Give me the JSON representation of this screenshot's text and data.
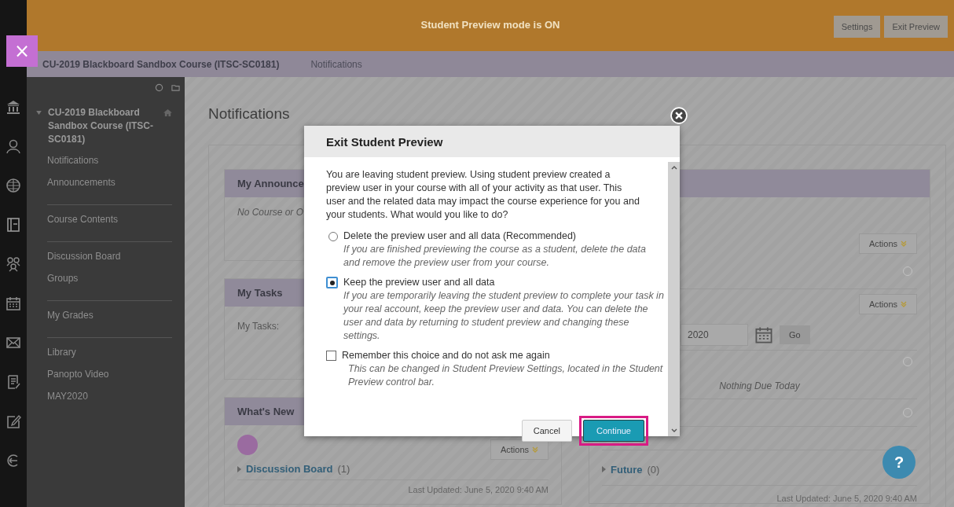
{
  "preview_bar": {
    "title": "Student Preview mode is ON",
    "buttons": [
      "Settings",
      "Exit Preview"
    ],
    "close_label": "×"
  },
  "breadcrumb": {
    "course": "CU-2019 Blackboard Sandbox Course (ITSC-SC0181)",
    "page": "Notifications"
  },
  "sidebar": {
    "course_title": "CU-2019 Blackboard Sandbox Course (ITSC-SC0181)",
    "groups": [
      {
        "items": [
          "Notifications",
          "Announcements"
        ]
      },
      {
        "items": [
          "Course Contents"
        ]
      },
      {
        "items": [
          "Discussion Board",
          "Groups"
        ]
      },
      {
        "items": [
          "My Grades"
        ]
      },
      {
        "items": [
          "Library",
          "Panopto Video",
          "MAY2020"
        ]
      }
    ]
  },
  "page": {
    "heading": "Notifications",
    "announcements": {
      "title": "My Announce",
      "body": "No Course or O"
    },
    "tasks": {
      "title": "My Tasks",
      "body": "My Tasks:"
    },
    "whats_new": {
      "title": "What's New",
      "actions": "Actions",
      "link": "Discussion Board",
      "count": "(1)",
      "updated": "Last Updated: June 5, 2020 9:40 AM"
    },
    "due": {
      "actions": [
        "Actions",
        "Actions"
      ],
      "date": "2020",
      "go": "Go",
      "empty": "Nothing Due Today",
      "future": "Future",
      "future_count": "(0)",
      "updated": "Last Updated: June 5, 2020 9:40 AM"
    }
  },
  "dialog": {
    "title": "Exit Student Preview",
    "intro": "You are leaving student preview. Using student preview created a preview user in your course with all of your activity as that user. This user and the related data may impact the course experience for you and your students. What would you like to do?",
    "options": [
      {
        "label": "Delete the preview user and all data (Recommended)",
        "hint": "If you are finished previewing the course as a student, delete the data and remove the preview user from your course.",
        "selected": false
      },
      {
        "label": "Keep the preview user and all data",
        "hint": "If you are temporarily leaving the student preview to complete your task in your real account, keep the preview user and data. You can delete the user and data by returning to student preview and changing these settings.",
        "selected": true
      }
    ],
    "remember": {
      "label": "Remember this choice and do not ask me again",
      "hint": "This can be changed in Student Preview Settings, located in the Student Preview control bar.",
      "checked": false
    },
    "buttons": [
      {
        "label": "Cancel",
        "kind": "secondary"
      },
      {
        "label": "Continue",
        "kind": "primary",
        "highlighted": true
      }
    ]
  },
  "help": {
    "label": "?"
  }
}
